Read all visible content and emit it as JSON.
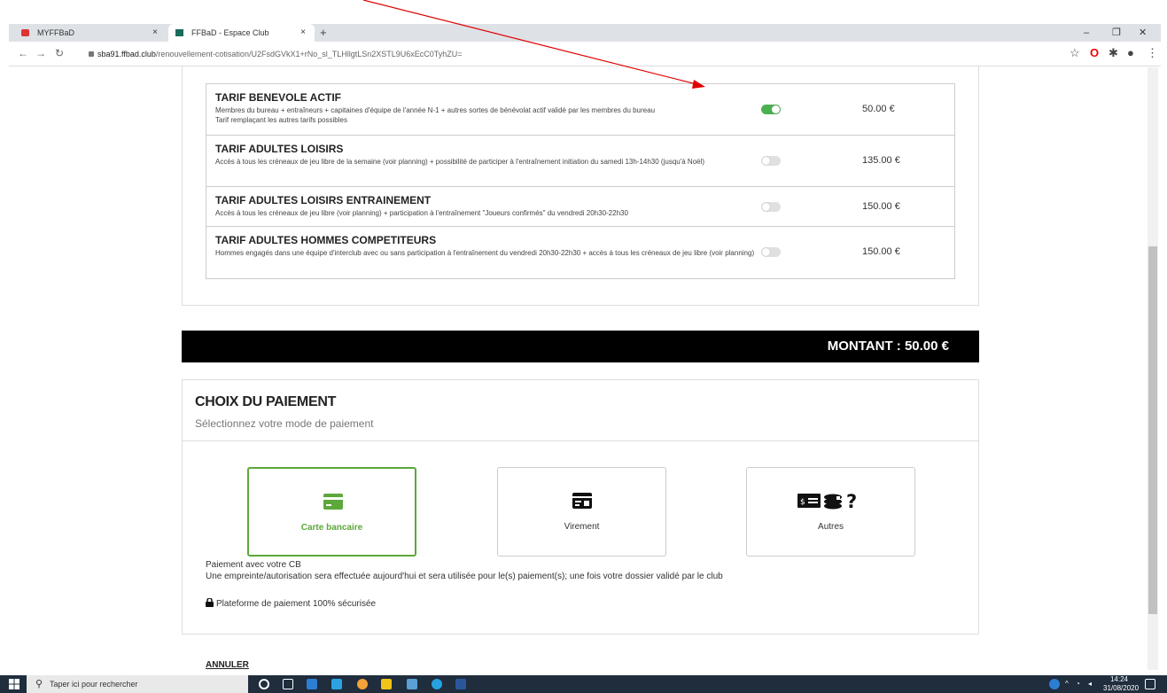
{
  "browser": {
    "tabs": [
      {
        "label": "MYFFBaD",
        "close": "×"
      },
      {
        "label": "FFBaD - Espace Club",
        "close": "×"
      }
    ],
    "new_tab": "+",
    "window_controls": {
      "minimize": "–",
      "restore": "❐",
      "close": "✕"
    },
    "url_host": "sba91.ffbad.club",
    "url_path": "/renouvellement-cotisation/U2FsdGVkX1+rNo_sl_TLHllgtLSn2XSTL9U6xEcC0TyhZU="
  },
  "tarifs": [
    {
      "title": "TARIF BENEVOLE ACTIF",
      "desc": "Membres du bureau + entraîneurs + capitaines d'équipe de l'année N-1 + autres sortes de bénévolat actif validé par les membres du bureau",
      "desc2": "Tarif remplaçant les autres tarifs possibles",
      "price": "50.00 €",
      "selected": true
    },
    {
      "title": "TARIF ADULTES LOISIRS",
      "desc": "Accès à tous les créneaux de jeu libre de la semaine (voir planning) + possibilité de participer à l'entraînement initiation du samedi 13h-14h30 (jusqu'à Noël)",
      "desc2": "",
      "price": "135.00 €",
      "selected": false
    },
    {
      "title": "TARIF ADULTES LOISIRS ENTRAINEMENT",
      "desc": "Accès à tous les créneaux de jeu libre (voir planning) + participation à l'entraînement \"Joueurs confirmés\" du vendredi 20h30-22h30",
      "desc2": "",
      "price": "150.00 €",
      "selected": false
    },
    {
      "title": "TARIF ADULTES HOMMES COMPETITEURS",
      "desc": "Hommes engagés dans une équipe d'interclub avec ou sans participation à l'entraînement du vendredi 20h30-22h30 + accès à tous les créneaux de jeu libre (voir planning)",
      "desc2": "",
      "price": "150.00 €",
      "selected": false
    }
  ],
  "montant": "MONTANT : 50.00 €",
  "paiement": {
    "title": "CHOIX DU PAIEMENT",
    "subtitle": "Sélectionnez votre mode de paiement",
    "options": [
      {
        "label": "Carte bancaire",
        "icon": "credit-card-icon",
        "selected": true
      },
      {
        "label": "Virement",
        "icon": "transfer-icon",
        "selected": false
      },
      {
        "label": "Autres",
        "icon": "cash-coins-question-icon",
        "selected": false
      }
    ],
    "info_line1": "Paiement avec votre CB",
    "info_line2": "Une empreinte/autorisation sera effectuée aujourd'hui et sera utilisée pour le(s) paiement(s); une fois votre dossier validé par le club",
    "secure": "Plateforme de paiement 100% sécurisée"
  },
  "annuler": "ANNULER",
  "taskbar": {
    "search_placeholder": "Taper ici pour rechercher",
    "time": "14:24",
    "date": "31/08/2020"
  },
  "colors": {
    "accent_green": "#5ca83a",
    "toggle_on": "#4caf50",
    "montant_bg": "#000000",
    "annotation_arrow": "#e00000"
  }
}
